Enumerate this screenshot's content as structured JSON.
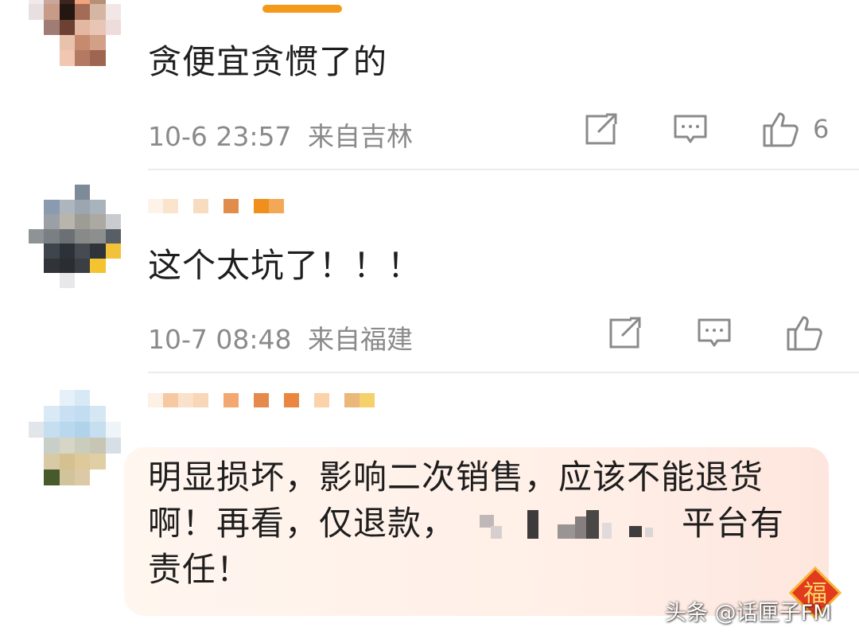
{
  "comments": [
    {
      "content": "贪便宜贪惯了的",
      "time": "10-6 23:57",
      "location": "来自吉林",
      "like_count": "6"
    },
    {
      "content": "这个太坑了！！！",
      "time": "10-7 08:48",
      "location": "来自福建",
      "like_count": ""
    },
    {
      "content_line1": "明显损坏，影响二次销售，应该不能退货",
      "content_line2_a": "啊！再看，仅退款，",
      "content_line2_b": "平台有",
      "content_line3": "责任！"
    }
  ],
  "badge_char": "福",
  "watermark": "头条 @话匣子FM",
  "icons": [
    "share-icon",
    "comment-icon",
    "like-icon"
  ],
  "colors": {
    "accent": "#f39a1a",
    "meta": "#8a8a8a",
    "badge": "#e23a1d"
  }
}
